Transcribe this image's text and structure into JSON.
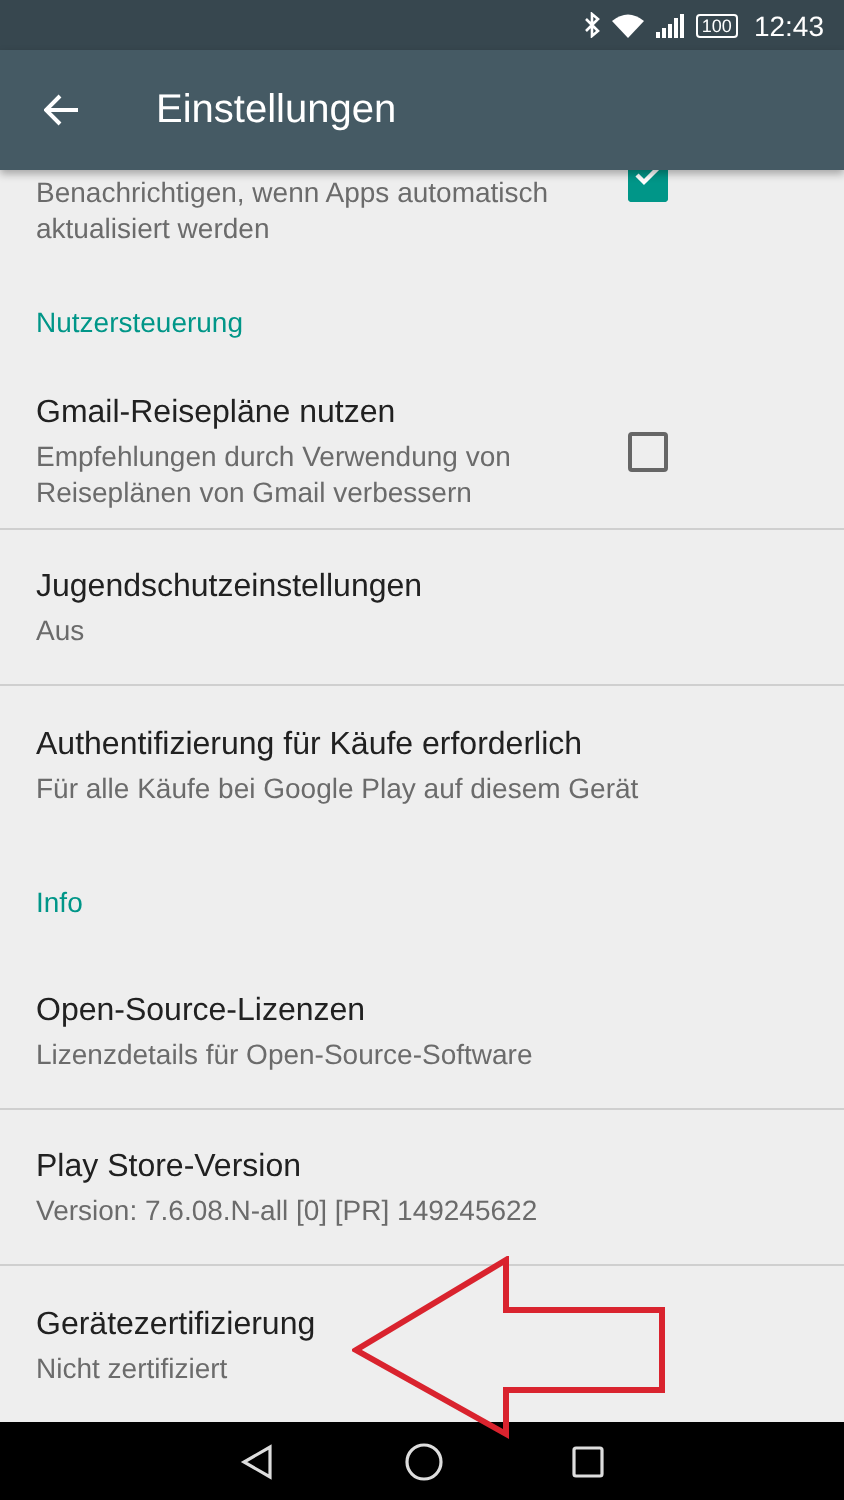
{
  "status_bar": {
    "battery": "100",
    "time": "12:43"
  },
  "app_bar": {
    "title": "Einstellungen"
  },
  "items": [
    {
      "kind": "setting",
      "summary": "Benachrichtigen, wenn Apps automatisch aktualisiert werden",
      "checked": true
    },
    {
      "kind": "header",
      "title": "Nutzersteuerung"
    },
    {
      "kind": "setting",
      "title": "Gmail-Reisepläne nutzen",
      "summary": "Empfehlungen durch Verwendung von Reiseplänen von Gmail verbessern",
      "checked": false
    },
    {
      "kind": "setting",
      "title": "Jugendschutzeinstellungen",
      "summary": "Aus"
    },
    {
      "kind": "setting",
      "title": "Authentifizierung für Käufe erforderlich",
      "summary": "Für alle Käufe bei Google Play auf diesem Gerät"
    },
    {
      "kind": "header",
      "title": "Info"
    },
    {
      "kind": "setting",
      "title": "Open-Source-Lizenzen",
      "summary": "Lizenzdetails für Open-Source-Software"
    },
    {
      "kind": "setting",
      "title": "Play Store-Version",
      "summary": "Version: 7.6.08.N-all [0] [PR] 149245622"
    },
    {
      "kind": "setting",
      "title": "Gerätezertifizierung",
      "summary": "Nicht zertifiziert"
    }
  ]
}
